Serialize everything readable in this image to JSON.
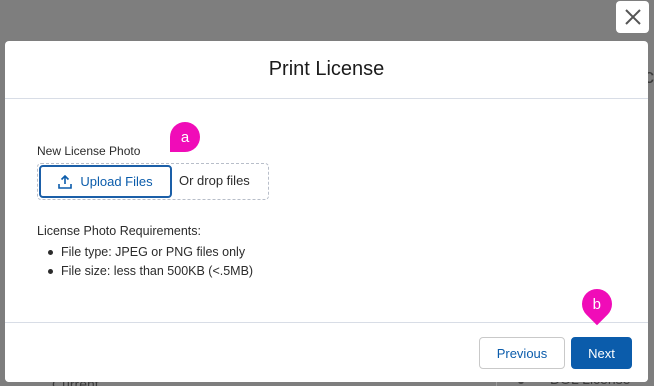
{
  "background": {
    "current_text": "Current",
    "license_text": "DOL License",
    "right_edge_char": "c"
  },
  "modal": {
    "title": "Print License",
    "field_label": "New License Photo",
    "upload_label": "Upload Files",
    "drop_text": "Or drop files",
    "requirements_title": "License Photo Requirements:",
    "requirements": [
      "File type: JPEG or PNG files only",
      "File size: less than 500KB (<.5MB)"
    ],
    "previous_label": "Previous",
    "next_label": "Next"
  },
  "annotations": {
    "marker_a": "a",
    "marker_b": "b"
  },
  "icons": {
    "close": "close-icon",
    "upload": "upload-icon"
  },
  "colors": {
    "brand": "#0b5cab",
    "overlay": "#7e7e7e",
    "marker": "#f00cb8"
  }
}
